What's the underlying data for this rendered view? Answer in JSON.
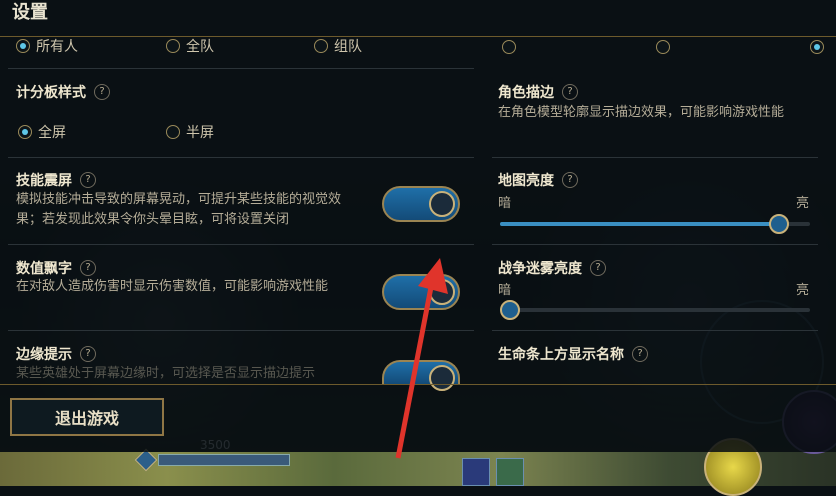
{
  "window": {
    "title": "设置"
  },
  "top_radio": {
    "left_options": [
      {
        "label": "所有人",
        "selected": true
      },
      {
        "label": "全队",
        "selected": false
      },
      {
        "label": "组队",
        "selected": false
      }
    ],
    "right_options_selected": [
      false,
      false,
      true
    ]
  },
  "scoreboard": {
    "title": "计分板样式",
    "help": "?",
    "options": [
      {
        "label": "全屏",
        "selected": true
      },
      {
        "label": "半屏",
        "selected": false
      }
    ]
  },
  "screen_shake": {
    "title": "技能震屏",
    "help": "?",
    "desc_line1": "模拟技能冲击导致的屏幕晃动，可提升某些技能的视觉效",
    "desc_line2": "果；若发现此效果令你头晕目眩，可将设置关闭",
    "enabled": true
  },
  "damage_numbers": {
    "title": "数值飘字",
    "help": "?",
    "desc": "在对敌人造成伤害时显示伤害数值，可能影响游戏性能",
    "enabled": true
  },
  "edge_hint": {
    "title": "边缘提示",
    "help": "?",
    "desc": "某些英雄处于屏幕边缘时，可选择是否显示描边提示",
    "enabled": true
  },
  "char_outline": {
    "title": "角色描边",
    "help": "?",
    "desc": "在角色模型轮廓显示描边效果，可能影响游戏性能"
  },
  "map_brightness": {
    "title": "地图亮度",
    "help": "?",
    "min_label": "暗",
    "max_label": "亮",
    "value_fraction": 0.9
  },
  "fog_brightness": {
    "title": "战争迷雾亮度",
    "help": "?",
    "min_label": "暗",
    "max_label": "亮",
    "value_fraction": 0.0
  },
  "health_bar_name": {
    "title": "生命条上方显示名称",
    "help": "?"
  },
  "footer": {
    "exit_label": "退出游戏"
  },
  "hud": {
    "gold_value": "3500"
  },
  "colors": {
    "accent_gold": "#9a8452",
    "accent_blue": "#3a8fc2",
    "arrow_red": "#e0342b"
  }
}
